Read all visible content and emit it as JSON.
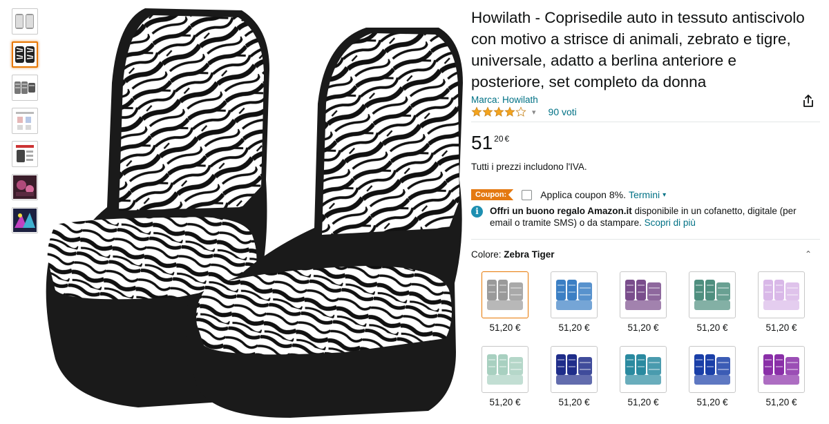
{
  "product": {
    "title": "Howilath - Coprisedile auto in tessuto antiscivolo con motivo a strisce di animali, zebrato e tigre, universale, adatto a berlina anteriore e posteriore, set completo da donna",
    "brand": "Marca: Howilath",
    "rating_stars": 4,
    "votes": "90 voti",
    "price_whole": "51",
    "price_fraction": "20",
    "price_currency": "€",
    "vat_note": "Tutti i prezzi includono l'IVA."
  },
  "coupon": {
    "badge": "Coupon:",
    "text": "Applica coupon 8%.",
    "terms": "Termini"
  },
  "gift": {
    "bold": "Offri un buono regalo Amazon.it",
    "text": " disponibile in un cofanetto, digitale (per email o tramite SMS) o da stampare. ",
    "link": "Scopri di più"
  },
  "color": {
    "label": "Colore: ",
    "selected": "Zebra Tiger"
  },
  "thumbnails": [
    {
      "icon": "seat-set-grey"
    },
    {
      "icon": "seat-zebra"
    },
    {
      "icon": "seat-set-rear"
    },
    {
      "icon": "size-chart"
    },
    {
      "icon": "installation-guide"
    },
    {
      "icon": "car-interior-pink"
    },
    {
      "icon": "car-interior-colorful"
    }
  ],
  "swatches": [
    {
      "price": "51,20 €",
      "color": "#9a9a9a"
    },
    {
      "price": "51,20 €",
      "color": "#3b7fc4"
    },
    {
      "price": "51,20 €",
      "color": "#7a4d8c"
    },
    {
      "price": "51,20 €",
      "color": "#4f8f7f"
    },
    {
      "price": "51,20 €",
      "color": "#d9b8e8"
    },
    {
      "price": "51,20 €",
      "color": "#a8d0c0"
    },
    {
      "price": "51,20 €",
      "color": "#1f2d8a"
    },
    {
      "price": "51,20 €",
      "color": "#2a8aa0"
    },
    {
      "price": "51,20 €",
      "color": "#1a3fa8"
    },
    {
      "price": "51,20 €",
      "color": "#8a2fa8"
    }
  ],
  "colors": {
    "link": "#007185",
    "coupon": "#e47911",
    "star": "#f4a41d",
    "selected_border": "#e77600"
  }
}
